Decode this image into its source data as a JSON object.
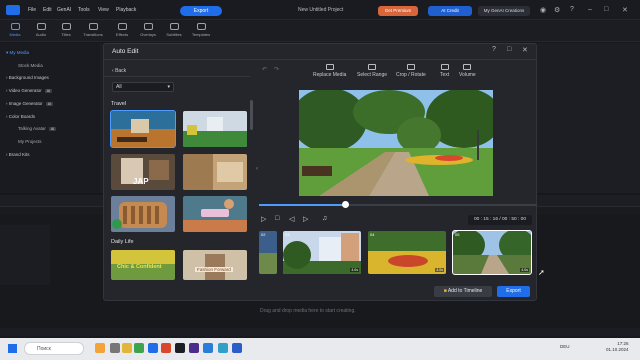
{
  "app": {
    "project_title": "New Untitled Project",
    "menu": [
      "File",
      "Edit",
      "GenAI",
      "Tools",
      "View",
      "Playback"
    ],
    "export_label": "Export",
    "pill_premium": "Get Premium",
    "pill_ai": "AI Credit",
    "pill_creations": "My GenAI Creations"
  },
  "toolbar": {
    "tabs": [
      "Media",
      "Audio",
      "Titles",
      "Transitions",
      "Effects",
      "Overlays",
      "Subtitles",
      "Templates"
    ]
  },
  "sidebar": {
    "items": [
      {
        "label": "My Media",
        "ai": false
      },
      {
        "label": "Stock Media",
        "ai": false
      },
      {
        "label": "Background Images",
        "ai": false
      },
      {
        "label": "Video Generator",
        "ai": true
      },
      {
        "label": "Image Generator",
        "ai": true
      },
      {
        "label": "Color Boards",
        "ai": false
      },
      {
        "label": "Talking Avatar",
        "ai": true
      },
      {
        "label": "My Projects",
        "ai": false
      },
      {
        "label": "Brand Kits",
        "ai": false
      }
    ],
    "ai_badge": "AI"
  },
  "timeline": {
    "drop_hint": "Drag and drop media here to start creating."
  },
  "taskbar": {
    "search_placeholder": "Поиск",
    "lang": "DEU",
    "time": "17:26",
    "date": "01.10.2024"
  },
  "modal": {
    "title": "Auto Edit",
    "back_label": "Back",
    "filter_value": "All",
    "sections": [
      {
        "title": "Travel"
      },
      {
        "title": "Daily Life"
      }
    ],
    "templates_travel": [
      {
        "caption": "",
        "duration": "",
        "colors": [
          "#b9742d",
          "#2c6f9a"
        ]
      },
      {
        "caption": "",
        "duration": "",
        "colors": [
          "#cfd9e3",
          "#3f8a3a"
        ]
      },
      {
        "caption": "JAP",
        "duration": "",
        "colors": [
          "#5a4a3c",
          "#d8c8b4"
        ]
      },
      {
        "caption": "",
        "duration": "",
        "colors": [
          "#9e7a50",
          "#c4a378"
        ]
      },
      {
        "caption": "",
        "duration": "",
        "colors": [
          "#c48a52",
          "#6b7e9a"
        ]
      },
      {
        "caption": "",
        "duration": "",
        "colors": [
          "#4e7a8c",
          "#c97c4a"
        ]
      }
    ],
    "templates_daily": [
      {
        "caption": "Chic & Confident",
        "colors": [
          "#d3c43b",
          "#6f9a3f"
        ]
      },
      {
        "caption": "Fashion Forward",
        "colors": [
          "#cfc0a8",
          "#9a7a5a"
        ]
      }
    ],
    "tools": [
      "Replace Media",
      "Select Range",
      "Crop / Rotate",
      "Text",
      "Volume"
    ],
    "timecode": "00 : 15 : 16 / 00 : 50 : 00",
    "progress": 0.31,
    "clips": [
      {
        "number": "02",
        "duration": "",
        "colors": [
          "#3b5f8a",
          "#6d8a4a"
        ]
      },
      {
        "number": "03",
        "duration": "4.0s",
        "colors": [
          "#e8eef5",
          "#3c6a2a"
        ]
      },
      {
        "number": "04",
        "duration": "4.0s",
        "colors": [
          "#3f6e2c",
          "#d8b52c"
        ]
      },
      {
        "number": "05",
        "duration": "4.0s",
        "colors": [
          "#9fc3e6",
          "#5a7a3c"
        ]
      }
    ],
    "add_to_timeline": "Add to Timeline",
    "export": "Export"
  }
}
